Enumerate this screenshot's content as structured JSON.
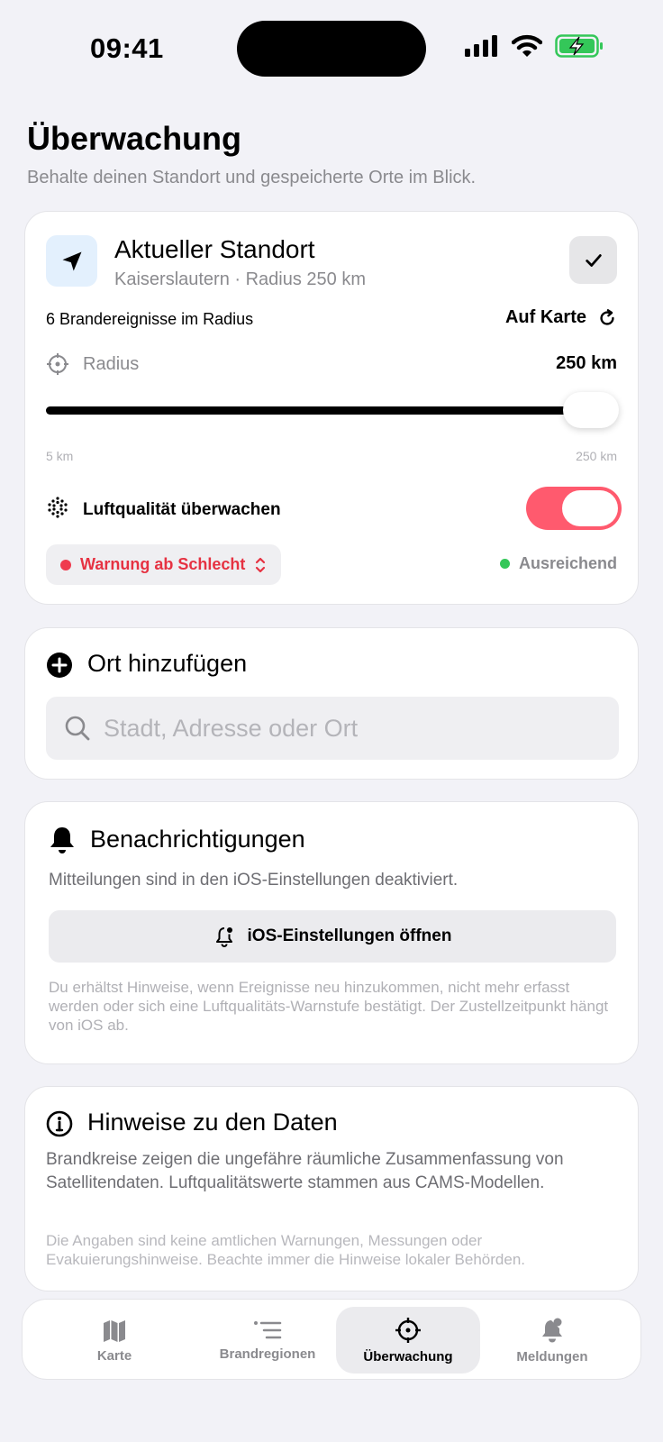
{
  "status_bar": {
    "time": "09:41"
  },
  "header": {
    "title": "Überwachung",
    "subtitle": "Behalte deinen Standort und gespeicherte Orte im Blick."
  },
  "current_location": {
    "title": "Aktueller Standort",
    "subtitle": "Kaiserslautern · Radius 250 km",
    "events_count": "6 Brandereignisse im Radius",
    "on_map_label": "Auf Karte",
    "radius_label": "Radius",
    "radius_value": "250 km",
    "slider": {
      "min_label": "5 km",
      "max_label": "250 km",
      "fraction": 1.0
    },
    "air_quality_label": "Luftqualität überwachen",
    "air_quality_enabled": true,
    "warning_threshold": "Warnung ab Schlecht",
    "air_status": "Ausreichend",
    "colors": {
      "warning": "#e63242",
      "good": "#34c759",
      "toggle_on": "#ff5a6e",
      "icon_bg": "#e3f0fd"
    }
  },
  "add_place": {
    "title": "Ort hinzufügen",
    "placeholder": "Stadt, Adresse oder Ort"
  },
  "notifications": {
    "title": "Benachrichtigungen",
    "description": "Mitteilungen sind in den iOS-Einstellungen deaktiviert.",
    "button_label": "iOS-Einstellungen öffnen",
    "note": "Du erhältst Hinweise, wenn Ereignisse neu hinzukommen, nicht mehr erfasst werden oder sich eine Luftqualitäts-Warnstufe bestätigt. Der Zustellzeitpunkt hängt von iOS ab."
  },
  "data_info": {
    "title": "Hinweise zu den Daten",
    "text": "Brandkreise zeigen die ungefähre räumliche Zusammenfassung von Satellitendaten. Luftqualitätswerte stammen aus CAMS-Modellen.",
    "note": "Die Angaben sind keine amtlichen Warnungen, Messungen oder Evakuierungshinweise. Beachte immer die Hinweise lokaler Behörden."
  },
  "tab_bar": {
    "tabs": [
      {
        "label": "Karte",
        "icon": "map-icon",
        "active": false
      },
      {
        "label": "Brandregionen",
        "icon": "list-icon",
        "active": false
      },
      {
        "label": "Überwachung",
        "icon": "crosshair-icon",
        "active": true
      },
      {
        "label": "Meldungen",
        "icon": "bell-badge-icon",
        "active": false
      }
    ]
  }
}
